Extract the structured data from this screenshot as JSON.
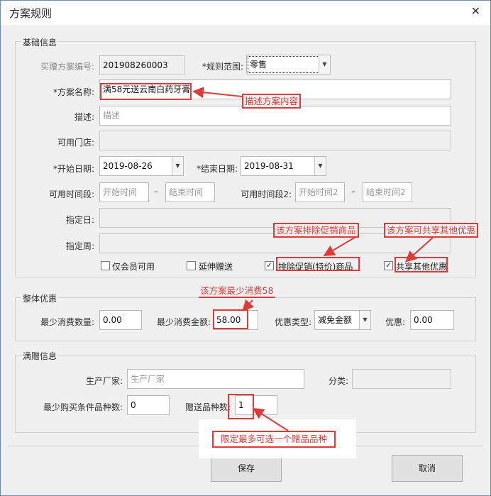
{
  "window": {
    "title": "方案规则"
  },
  "basic": {
    "group_title": "基础信息",
    "code_label": "买赠方案编号:",
    "code_value": "201908260003",
    "scope_label": "*规则范围:",
    "scope_value": "零售",
    "name_label": "*方案名称:",
    "name_value": "满58元送云南白药牙膏",
    "desc_label": "描述:",
    "desc_placeholder": "描述",
    "store_label": "可用门店:",
    "start_date_label": "*开始日期:",
    "start_date_value": "2019-08-26",
    "end_date_label": "*结束日期:",
    "end_date_value": "2019-08-31",
    "period1_label": "可用时间段:",
    "period1_start_ph": "开始时间",
    "period1_end_ph": "结束时间",
    "dash": "–",
    "period2_label": "可用时间段2:",
    "period2_start_ph": "开始时间2",
    "period2_end_ph": "结束时间2",
    "day_label": "指定日:",
    "week_label": "指定周:",
    "member_only": {
      "label": "仅会员可用",
      "checked": false
    },
    "extend_gift": {
      "label": "延伸赠送",
      "checked": false
    },
    "exclude_promo": {
      "label": "排除促销(特价)商品",
      "checked": true
    },
    "share_other": {
      "label": "共享其他优惠",
      "checked": true
    }
  },
  "discount": {
    "group_title": "整体优惠",
    "min_qty_label": "最少消费数量:",
    "min_qty_value": "0.00",
    "min_amount_label": "最少消费金额:",
    "min_amount_value": "58.00",
    "type_label": "优惠类型:",
    "type_value": "减免金额",
    "discount_label": "优惠:",
    "discount_value": "0.00"
  },
  "gift": {
    "group_title": "满赠信息",
    "maker_label": "生产厂家:",
    "maker_placeholder": "生产厂家",
    "category_label": "分类:",
    "min_kinds_label": "最少购买条件品种数:",
    "min_kinds_value": "0",
    "gift_kinds_label": "赠送品种数:",
    "gift_kinds_value": "1"
  },
  "annotations": {
    "desc_note": "描述方案内容",
    "exclude_note": "该方案排除促销商品",
    "share_note": "该方案可共享其他优惠",
    "min_amount_note": "该方案最少消费58",
    "gift_note": "限定最多可选一个赠品品种",
    "color": "#e03b3b"
  },
  "buttons": {
    "save": "保存",
    "cancel": "取消"
  }
}
